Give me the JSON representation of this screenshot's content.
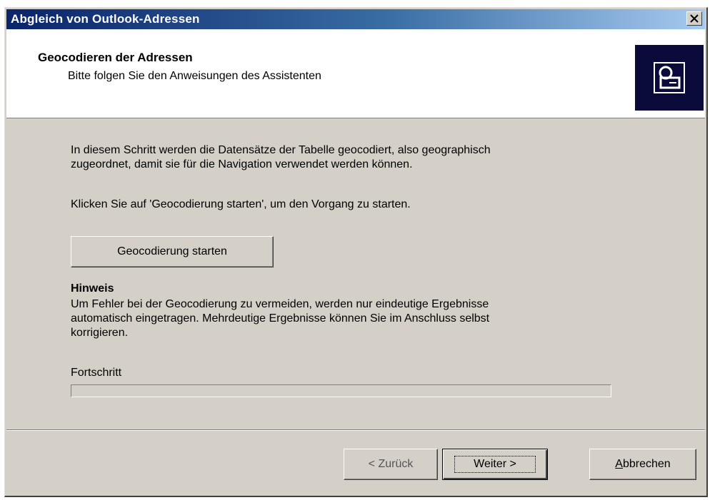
{
  "window": {
    "title": "Abgleich von Outlook-Adressen",
    "close_label": "×"
  },
  "header": {
    "title": "Geocodieren der Adressen",
    "subtitle": "Bitte folgen Sie den Anweisungen des Assistenten",
    "icon": "wizard-address-icon"
  },
  "content": {
    "intro_line1": "In diesem Schritt werden die Datensätze der Tabelle geocodiert, also geographisch",
    "intro_line2": "zugeordnet, damit sie für die Navigation verwendet werden können.",
    "instruction": "Klicken Sie auf 'Geocodierung starten', um den Vorgang zu starten.",
    "start_button": "Geocodierung starten",
    "hint_title": "Hinweis",
    "hint_line1": "Um Fehler bei der Geocodierung zu vermeiden, werden nur eindeutige Ergebnisse",
    "hint_line2": "automatisch eingetragen. Mehrdeutige Ergebnisse können Sie im Anschluss selbst",
    "hint_line3": "korrigieren.",
    "progress_label": "Fortschritt",
    "progress_value": 0
  },
  "footer": {
    "back_label": "< Zurück",
    "next_label": "Weiter >",
    "cancel_label_first": "A",
    "cancel_label_rest": "bbrechen"
  },
  "colors": {
    "titlebar_start": "#0a246a",
    "titlebar_end": "#a6caf0",
    "dialog_bg": "#d4d0c8",
    "icon_bg": "#0a0a3a"
  }
}
